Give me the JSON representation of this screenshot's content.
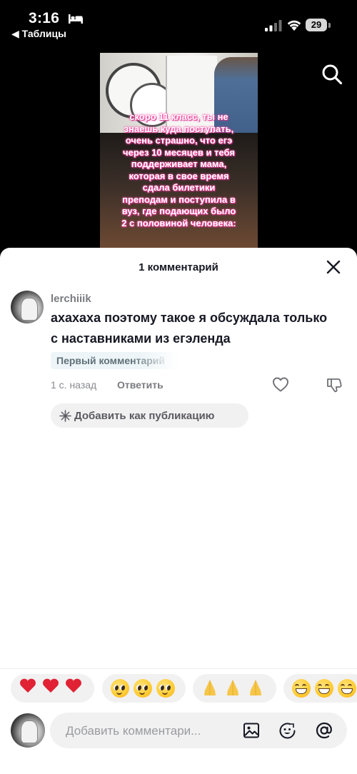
{
  "status_bar": {
    "time": "3:16",
    "back_app": "◀ Таблицы",
    "battery": "29",
    "icons": [
      "bed-icon",
      "signal-icon",
      "wifi-icon",
      "battery-icon"
    ]
  },
  "video": {
    "caption": "скоро 11 класс, ты не\nзнаешь куда поступать,\nочень страшно, что егэ\nчерез 10 месяцев и тебя\nподдерживает мама,\nкоторая в свое время\nсдала билетики\nпреподам и поступила в\nвуз, где подающих было\n2 с половиной человека:",
    "search_icon": "search-icon"
  },
  "comments_sheet": {
    "title": "1 комментарий",
    "close_icon": "close-icon",
    "comment": {
      "username": "lerchiiik",
      "text": "ахахаха поэтому такое я обсуждала только с наставниками из егэленда",
      "badge": "Первый комментарий",
      "time_ago": "1 с. назад",
      "reply_label": "Ответить",
      "icons": [
        "heart-outline-icon",
        "dislike-icon"
      ]
    },
    "add_publication_label": "Добавить как публикацию",
    "emoji_groups": [
      {
        "name": "broken-heart",
        "emoji": [
          "💔",
          "💔",
          "💔"
        ]
      },
      {
        "name": "pleading-face",
        "emoji": [
          "🥺",
          "🥺",
          "🥺"
        ]
      },
      {
        "name": "folded-hands",
        "emoji": [
          "🙏",
          "🙏",
          "🙏"
        ]
      },
      {
        "name": "grinning-face",
        "emoji": [
          "😁",
          "😁",
          "😁"
        ]
      }
    ],
    "input": {
      "placeholder": "Добавить комментари...",
      "value": "",
      "icons": [
        "image-icon",
        "emoji-face-icon",
        "at-mention-icon"
      ]
    }
  },
  "colors": {
    "caption_glow": "#ff4fa8",
    "broken_heart": "#e02234",
    "sheet_bg": "#ffffff",
    "chip_bg": "#f1f1f2"
  }
}
